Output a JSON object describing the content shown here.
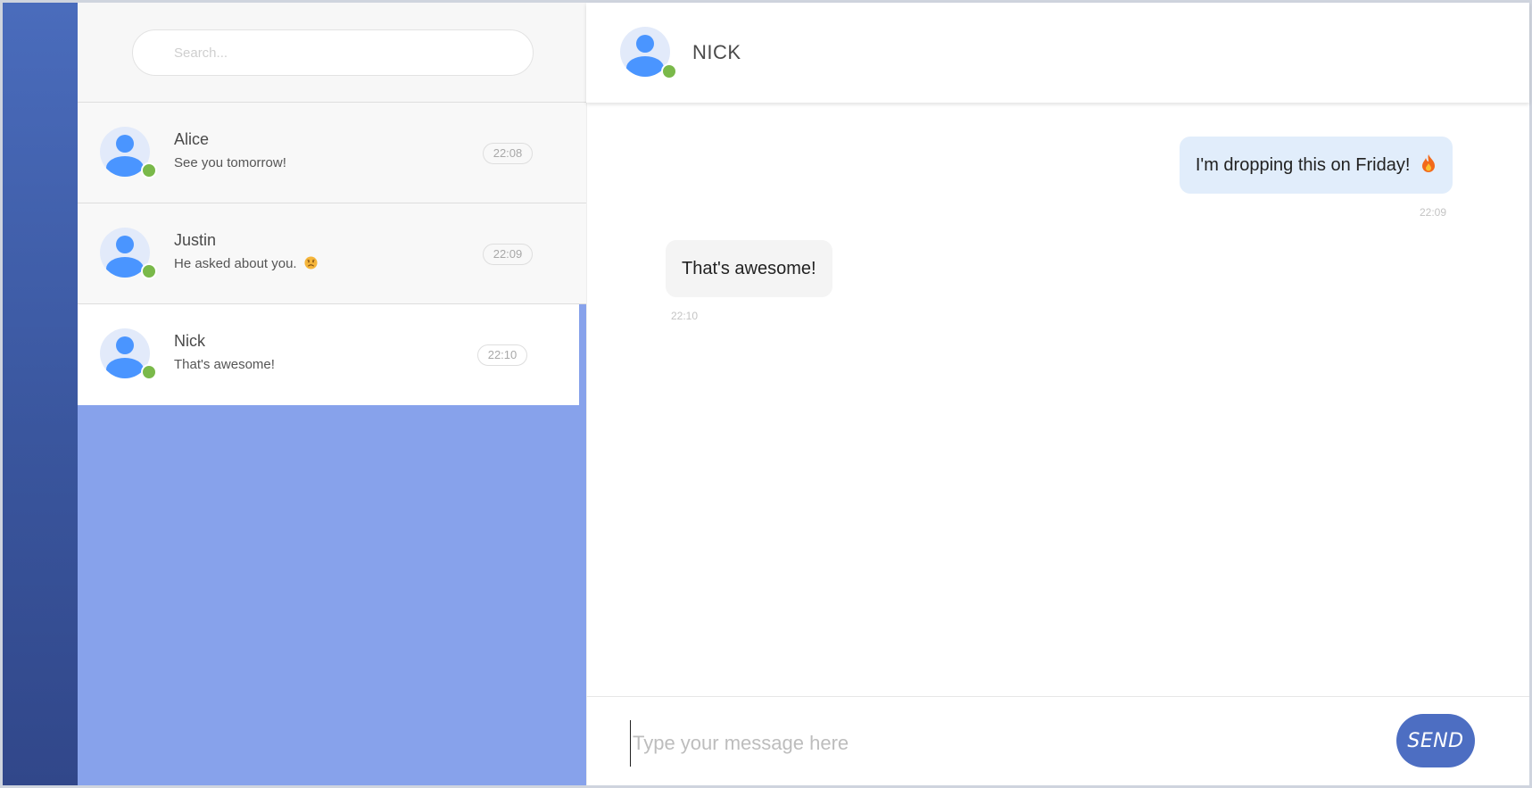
{
  "search": {
    "placeholder": "Search..."
  },
  "contacts": [
    {
      "name": "Alice",
      "preview": "See you tomorrow!",
      "time": "22:08",
      "status": "online",
      "active": false
    },
    {
      "name": "Justin",
      "preview": "He asked about you.",
      "preview_emoji": "worried-face-emoji",
      "time": "22:09",
      "status": "online",
      "active": false
    },
    {
      "name": "Nick",
      "preview": "That's awesome!",
      "time": "22:10",
      "status": "online",
      "active": true
    }
  ],
  "chat": {
    "title": "NICK",
    "status": "online",
    "messages": [
      {
        "direction": "outgoing",
        "text": "I'm dropping this on Friday!",
        "emoji": "fire-emoji",
        "time": "22:09"
      },
      {
        "direction": "incoming",
        "text": "That's awesome!",
        "time": "22:10"
      }
    ]
  },
  "composer": {
    "placeholder": "Type your message here",
    "value": "",
    "send_label": "SEND"
  },
  "colors": {
    "rail_top": "#4a6cbc",
    "rail_bottom": "#31478a",
    "list_background": "#87a2eb",
    "outgoing_bubble": "#e1edfb",
    "incoming_bubble": "#f4f4f4",
    "online_status": "#7ab94a",
    "send_button": "#4d6ec2",
    "avatar_figure": "#4a95ff"
  }
}
